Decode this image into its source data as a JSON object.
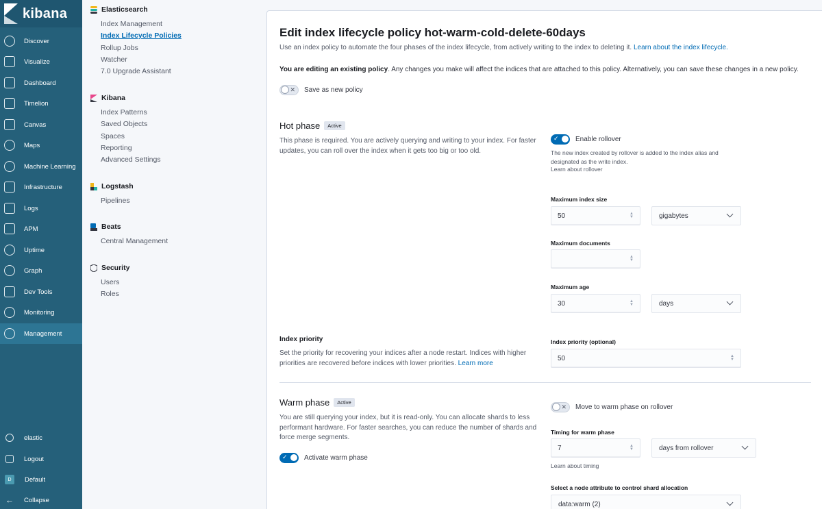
{
  "app": {
    "logo_text": "kibana"
  },
  "nav": {
    "items": [
      {
        "label": "Discover",
        "icon": "compass-icon"
      },
      {
        "label": "Visualize",
        "icon": "visualize-icon"
      },
      {
        "label": "Dashboard",
        "icon": "dashboard-icon"
      },
      {
        "label": "Timelion",
        "icon": "timelion-icon"
      },
      {
        "label": "Canvas",
        "icon": "canvas-icon"
      },
      {
        "label": "Maps",
        "icon": "maps-icon"
      },
      {
        "label": "Machine Learning",
        "icon": "machine-learning-icon"
      },
      {
        "label": "Infrastructure",
        "icon": "infrastructure-icon"
      },
      {
        "label": "Logs",
        "icon": "logs-icon"
      },
      {
        "label": "APM",
        "icon": "apm-icon"
      },
      {
        "label": "Uptime",
        "icon": "uptime-icon"
      },
      {
        "label": "Graph",
        "icon": "graph-icon"
      },
      {
        "label": "Dev Tools",
        "icon": "dev-tools-icon"
      },
      {
        "label": "Monitoring",
        "icon": "monitoring-icon"
      },
      {
        "label": "Management",
        "icon": "gear-icon"
      }
    ],
    "bottom": {
      "user": "elastic",
      "logout": "Logout",
      "space_badge": "D",
      "space": "Default",
      "collapse": "Collapse"
    }
  },
  "sidebar": {
    "elasticsearch": {
      "title": "Elasticsearch",
      "links": [
        "Index Management",
        "Index Lifecycle Policies",
        "Rollup Jobs",
        "Watcher",
        "7.0 Upgrade Assistant"
      ]
    },
    "kibana": {
      "title": "Kibana",
      "links": [
        "Index Patterns",
        "Saved Objects",
        "Spaces",
        "Reporting",
        "Advanced Settings"
      ]
    },
    "logstash": {
      "title": "Logstash",
      "links": [
        "Pipelines"
      ]
    },
    "beats": {
      "title": "Beats",
      "links": [
        "Central Management"
      ]
    },
    "security": {
      "title": "Security",
      "links": [
        "Users",
        "Roles"
      ]
    }
  },
  "page": {
    "title": "Edit index lifecycle policy hot-warm-cold-delete-60days",
    "intro": "Use an index policy to automate the four phases of the index lifecycle, from actively writing to the index to deleting it.",
    "intro_link": "Learn about the index lifecycle.",
    "editing_bold": "You are editing an existing policy",
    "editing_rest": ". Any changes you make will affect the indices that are attached to this policy. Alternatively, you can save these changes in a new policy.",
    "save_as_new": "Save as new policy"
  },
  "hot": {
    "title": "Hot phase",
    "badge": "Active",
    "desc": "This phase is required. You are actively querying and writing to your index. For faster updates, you can roll over the index when it gets too big or too old.",
    "enable_rollover": "Enable rollover",
    "rollover_help": "The new index created by rollover is added to the index alias and designated as the write index.",
    "rollover_link": "Learn about rollover",
    "max_size_label": "Maximum index size",
    "max_size_value": "50",
    "max_size_unit": "gigabytes",
    "max_docs_label": "Maximum documents",
    "max_docs_value": "",
    "max_age_label": "Maximum age",
    "max_age_value": "30",
    "max_age_unit": "days",
    "priority_title": "Index priority",
    "priority_desc": "Set the priority for recovering your indices after a node restart. Indices with higher priorities are recovered before indices with lower priorities.",
    "priority_link": "Learn more",
    "priority_label": "Index priority (optional)",
    "priority_value": "50"
  },
  "warm": {
    "title": "Warm phase",
    "badge": "Active",
    "desc": "You are still querying your index, but it is read-only. You can allocate shards to less performant hardware. For faster searches, you can reduce the number of shards and force merge segments.",
    "activate": "Activate warm phase",
    "move_on_rollover": "Move to warm phase on rollover",
    "timing_label": "Timing for warm phase",
    "timing_value": "7",
    "timing_unit": "days from rollover",
    "timing_link": "Learn about timing",
    "node_attr_label": "Select a node attribute to control shard allocation",
    "node_attr_value": "data:warm (2)"
  }
}
